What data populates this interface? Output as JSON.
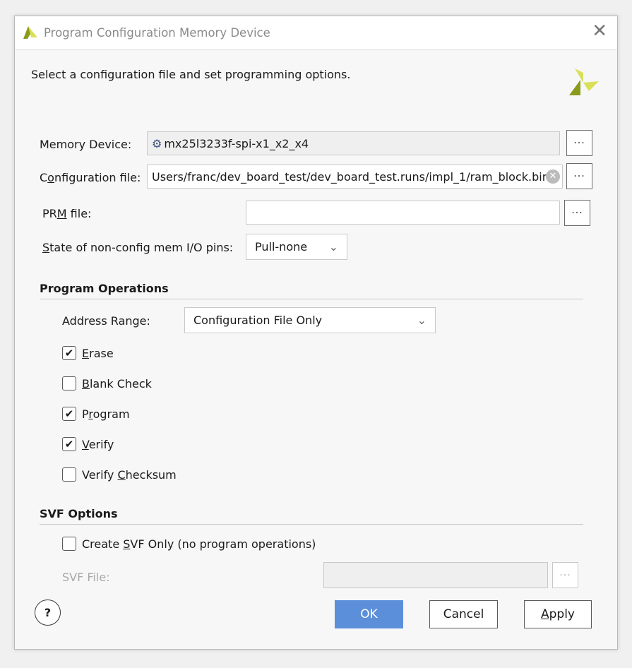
{
  "window": {
    "title": "Program Configuration Memory Device",
    "close_icon": "close-icon"
  },
  "instructions": "Select a configuration file and set programming options.",
  "memory_device": {
    "label": "Memory Device:",
    "value": "mx25l3233f-spi-x1_x2_x4",
    "browse": "···"
  },
  "config_file": {
    "label": {
      "pre": "C",
      "key": "o",
      "post": "nfiguration file:"
    },
    "value": "'Users/franc/dev_board_test/dev_board_test.runs/impl_1/ram_block.bin",
    "browse": "···"
  },
  "prm_file": {
    "label": {
      "pre": "PR",
      "key": "M",
      "post": " file:"
    },
    "value": "",
    "browse": "···"
  },
  "io_pins": {
    "label": {
      "pre": "",
      "key": "S",
      "post": "tate of non-config mem I/O pins:"
    },
    "value": "Pull-none"
  },
  "program_operations": {
    "title": "Program Operations",
    "address_range_label": "Address Range:",
    "address_range_value": "Configuration File Only",
    "checks": [
      {
        "pre": "",
        "key": "E",
        "post": "rase",
        "checked": true
      },
      {
        "pre": "",
        "key": "B",
        "post": "lank Check",
        "checked": false
      },
      {
        "pre": "P",
        "key": "r",
        "post": "ogram",
        "checked": true
      },
      {
        "pre": "",
        "key": "V",
        "post": "erify",
        "checked": true
      },
      {
        "pre": "Verify ",
        "key": "C",
        "post": "hecksum",
        "checked": false
      }
    ]
  },
  "svf_options": {
    "title": "SVF Options",
    "create": {
      "pre": "Create ",
      "key": "S",
      "post": "VF Only (no program operations)",
      "checked": false
    },
    "file_label": "SVF File:",
    "file_value": "",
    "browse": "···"
  },
  "buttons": {
    "help": "?",
    "ok": "OK",
    "cancel": "Cancel",
    "apply": {
      "pre": "",
      "key": "A",
      "post": "pply"
    }
  },
  "colors": {
    "ok_button": "#5b8fd9",
    "logo_light": "#d8e05a",
    "logo_dark": "#8a9a1a"
  }
}
